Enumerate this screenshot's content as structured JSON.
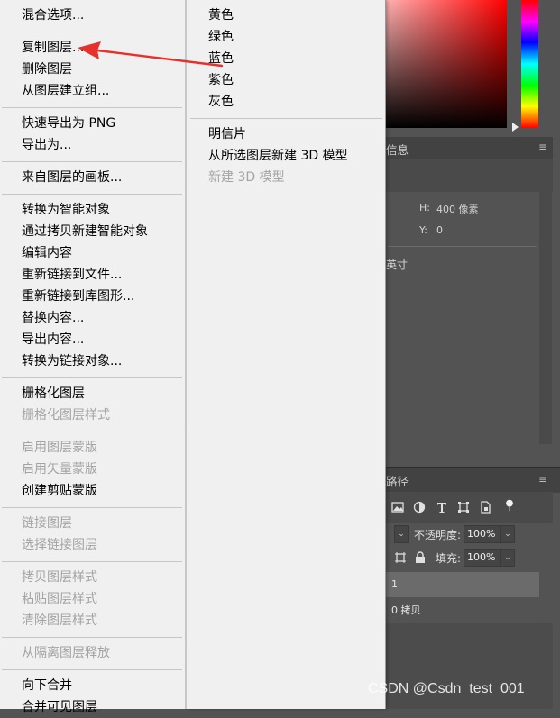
{
  "background_panels": {
    "info_tab": "信息",
    "info_h_label": "H:",
    "info_h_value": "400 像素",
    "info_y_label": "Y:",
    "info_y_value": "0",
    "info_unit": "英寸",
    "layers_tab": "路径",
    "panel_menu_icon": "≡",
    "opacity_label": "不透明度:",
    "opacity_value": "100%",
    "fill_label": "填充:",
    "fill_value": "100%",
    "layer_rows": [
      "1",
      "0 拷贝"
    ]
  },
  "main_menu": {
    "items": [
      {
        "label": "混合选项...",
        "enabled": true
      },
      {
        "label": "复制图层...",
        "enabled": true
      },
      {
        "label": "删除图层",
        "enabled": true
      },
      {
        "label": "从图层建立组...",
        "enabled": true
      },
      {
        "label": "快速导出为 PNG",
        "enabled": true
      },
      {
        "label": "导出为...",
        "enabled": true
      },
      {
        "label": "来自图层的画板...",
        "enabled": true
      },
      {
        "label": "转换为智能对象",
        "enabled": true
      },
      {
        "label": "通过拷贝新建智能对象",
        "enabled": true
      },
      {
        "label": "编辑内容",
        "enabled": true
      },
      {
        "label": "重新链接到文件...",
        "enabled": true
      },
      {
        "label": "重新链接到库图形...",
        "enabled": true
      },
      {
        "label": "替换内容...",
        "enabled": true
      },
      {
        "label": "导出内容...",
        "enabled": true
      },
      {
        "label": "转换为链接对象...",
        "enabled": true
      },
      {
        "label": "栅格化图层",
        "enabled": true
      },
      {
        "label": "栅格化图层样式",
        "enabled": false
      },
      {
        "label": "启用图层蒙版",
        "enabled": false
      },
      {
        "label": "启用矢量蒙版",
        "enabled": false
      },
      {
        "label": "创建剪贴蒙版",
        "enabled": true
      },
      {
        "label": "链接图层",
        "enabled": false
      },
      {
        "label": "选择链接图层",
        "enabled": false
      },
      {
        "label": "拷贝图层样式",
        "enabled": false
      },
      {
        "label": "粘贴图层样式",
        "enabled": false
      },
      {
        "label": "清除图层样式",
        "enabled": false
      },
      {
        "label": "从隔离图层释放",
        "enabled": false
      },
      {
        "label": "向下合并",
        "enabled": true
      },
      {
        "label": "合并可见图层",
        "enabled": true
      }
    ]
  },
  "sub_menu": {
    "items": [
      {
        "label": "黄色",
        "enabled": true
      },
      {
        "label": "绿色",
        "enabled": true
      },
      {
        "label": "蓝色",
        "enabled": true
      },
      {
        "label": "紫色",
        "enabled": true
      },
      {
        "label": "灰色",
        "enabled": true
      },
      {
        "label": "明信片",
        "enabled": true
      },
      {
        "label": "从所选图层新建 3D 模型",
        "enabled": true
      },
      {
        "label": "新建 3D 模型",
        "enabled": false
      }
    ]
  },
  "watermark": "CSDN @Csdn_test_001",
  "colors": {
    "menu_bg": "#f0f0f0",
    "disabled_text": "#a3a3a3",
    "annotation_arrow": "#e8302a"
  }
}
